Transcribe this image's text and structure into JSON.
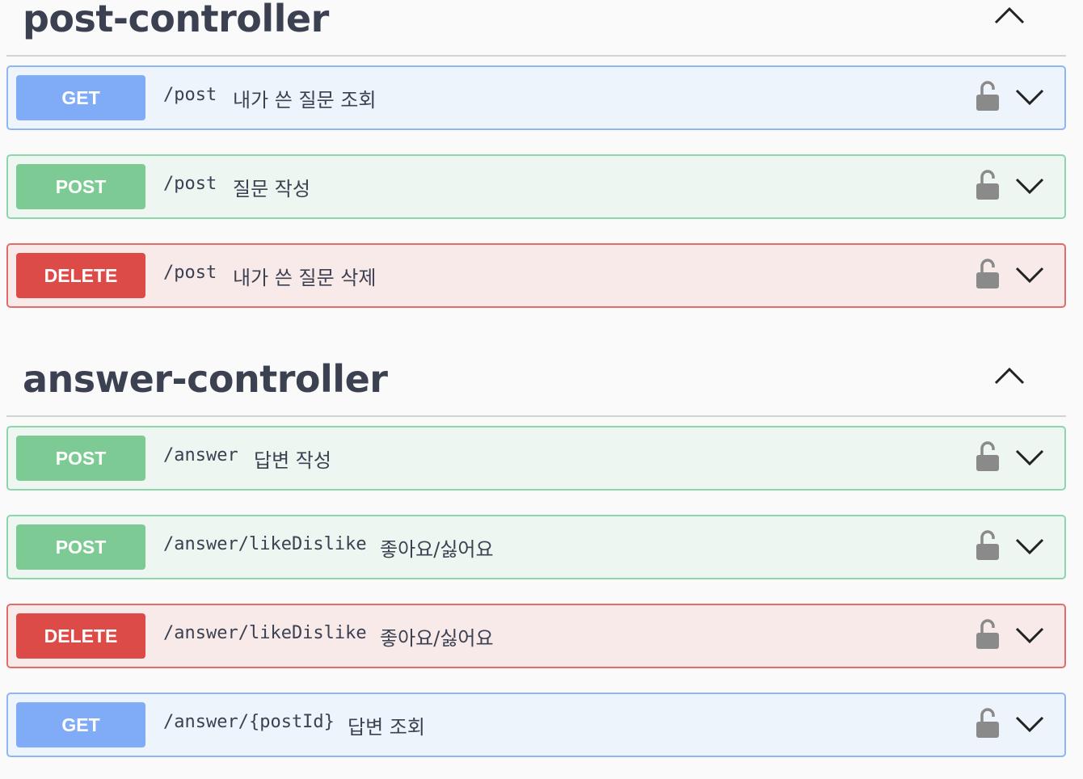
{
  "sections": [
    {
      "title": "post-controller",
      "operations": [
        {
          "method": "GET",
          "path": "/post",
          "summary": "내가 쓴 질문 조회"
        },
        {
          "method": "POST",
          "path": "/post",
          "summary": "질문 작성"
        },
        {
          "method": "DELETE",
          "path": "/post",
          "summary": "내가 쓴 질문 삭제"
        }
      ]
    },
    {
      "title": "answer-controller",
      "operations": [
        {
          "method": "POST",
          "path": "/answer",
          "summary": "답변 작성"
        },
        {
          "method": "POST",
          "path": "/answer/likeDislike",
          "summary": "좋아요/싫어요"
        },
        {
          "method": "DELETE",
          "path": "/answer/likeDislike",
          "summary": "좋아요/싫어요"
        },
        {
          "method": "GET",
          "path": "/answer/{postId}",
          "summary": "답변 조회"
        }
      ]
    }
  ],
  "icons": {
    "section_toggle": "chevron-up-icon",
    "lock": "unlocked-padlock-icon",
    "expand": "chevron-down-icon"
  },
  "colors": {
    "get": "#80acf7",
    "post": "#7dca95",
    "delete": "#dc4b47",
    "title": "#3b4151"
  }
}
